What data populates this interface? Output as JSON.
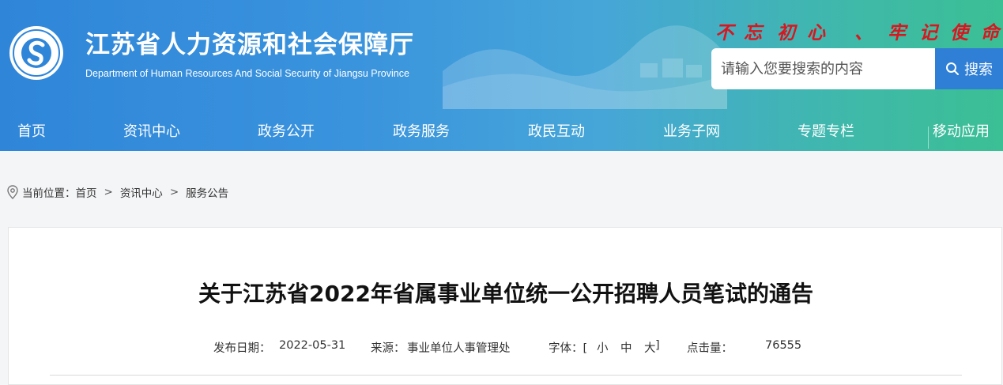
{
  "header": {
    "title": "江苏省人力资源和社会保障厅",
    "subtitle": "Department of Human Resources And Social Security of Jiangsu Province",
    "slogan": [
      "不",
      "忘",
      "初",
      "心",
      "、",
      "牢",
      "记",
      "使",
      "命"
    ],
    "search": {
      "placeholder": "请输入您要搜索的内容",
      "button_label": "搜索"
    }
  },
  "nav": {
    "items": [
      "首页",
      "资讯中心",
      "政务公开",
      "政务服务",
      "政民互动",
      "业务子网",
      "专题专栏",
      "移动应用"
    ]
  },
  "breadcrumb": {
    "prefix": "当前位置：",
    "items": [
      "首页",
      "资讯中心",
      "服务公告"
    ],
    "separator": ">"
  },
  "article": {
    "title": "关于江苏省2022年省属事业单位统一公开招聘人员笔试的通告",
    "date_label": "发布日期：",
    "date": "2022-05-31",
    "source_label": "来源：",
    "source": "事业单位人事管理处",
    "font_label": "字体：[",
    "font_small": "小",
    "font_medium": "中",
    "font_large": "大",
    "font_close": "]",
    "hits_label": "点击量：",
    "hits": "76555"
  },
  "colors": {
    "header_blue": "#2f86d9",
    "header_green": "#3bbf94",
    "search_button": "#2f7fd6",
    "slogan_red": "#d9161f"
  }
}
